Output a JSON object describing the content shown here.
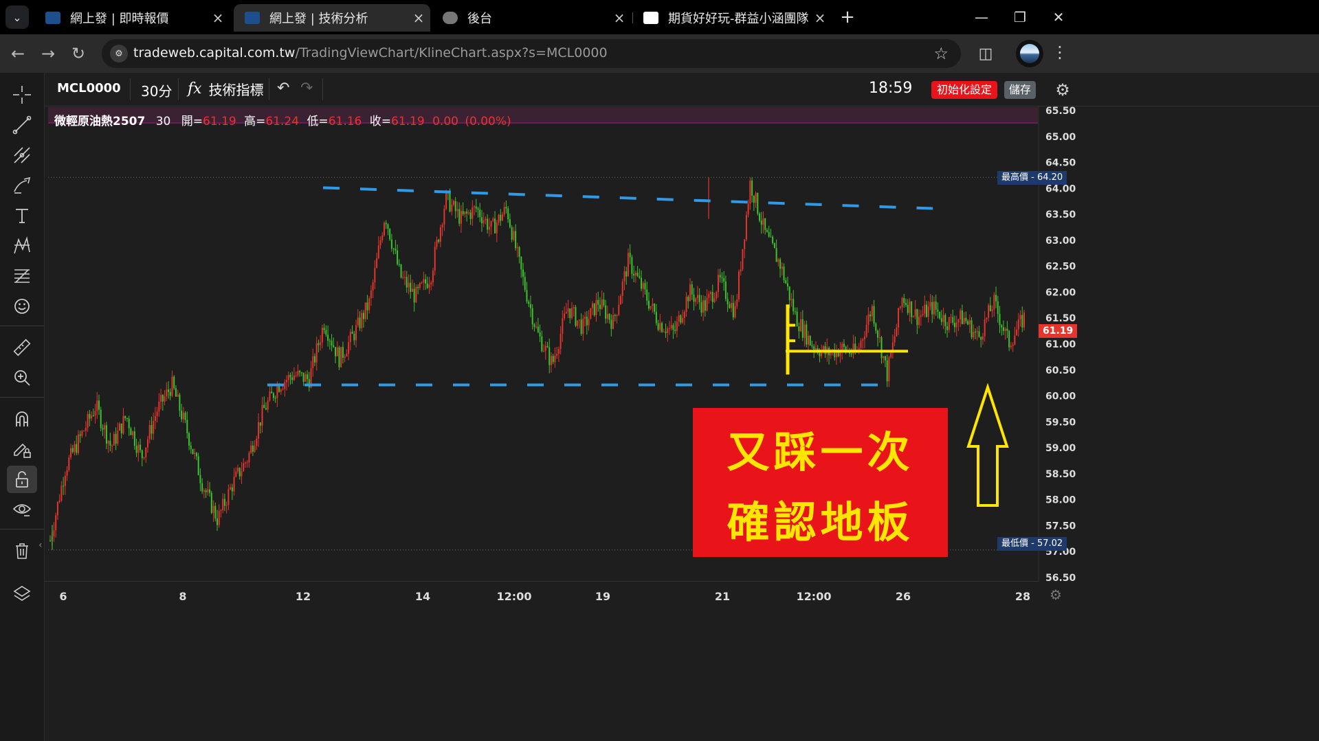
{
  "browser": {
    "tabs": [
      {
        "label": "網上發 | 即時報價",
        "active": false
      },
      {
        "label": "網上發 | 技術分析",
        "active": true
      },
      {
        "label": "後台",
        "active": false
      },
      {
        "label": "期貨好好玩-群益小涵團隊|唯一",
        "active": false
      }
    ],
    "url_host": "tradeweb.capital.com.tw",
    "url_path": "/TradingViewChart/KlineChart.aspx?s=MCL0000"
  },
  "toolbar": {
    "symbol": "MCL0000",
    "interval": "30分",
    "indicators_label": "技術指標",
    "indicators_icon": "fx",
    "time": "18:59",
    "reset_label": "初始化設定",
    "save_label": "儲存"
  },
  "legend": {
    "name": "微輕原油熱2507",
    "interval": "30",
    "open_label": "開=",
    "open": "61.19",
    "high_label": "高=",
    "high": "61.24",
    "low_label": "低=",
    "low": "61.16",
    "close_label": "收=",
    "close": "61.19",
    "change": "0.00",
    "change_pct": "(0.00%)"
  },
  "price_tags": {
    "high_label": "最高價",
    "high_value": "64.20",
    "low_label": "最低價",
    "low_value": "57.02",
    "last_value": "61.19"
  },
  "annotation": {
    "line1": "又踩一次",
    "line2": "確認地板"
  },
  "colors": {
    "up": "#e5352c",
    "down": "#3cc42a",
    "dashed_lines": "#2f9be8",
    "annotation_bg": "#e8141a",
    "annotation_text": "#ffe600",
    "marker": "#ffe600"
  },
  "chart_data": {
    "type": "candlestick",
    "symbol": "MCL0000",
    "y_ticks": [
      "65.50",
      "65.00",
      "64.50",
      "64.00",
      "63.50",
      "63.00",
      "62.50",
      "62.00",
      "61.50",
      "61.00",
      "60.50",
      "60.00",
      "59.50",
      "59.00",
      "58.50",
      "58.00",
      "57.50",
      "57.00",
      "56.50"
    ],
    "ylim": [
      56.5,
      65.5
    ],
    "x_ticks": [
      "6",
      "8",
      "12",
      "14",
      "12:00",
      "19",
      "21",
      "12:00",
      "26",
      "28"
    ],
    "close_path": [
      57.2,
      58.6,
      59.2,
      59.8,
      59.0,
      59.6,
      58.8,
      59.7,
      60.2,
      59.3,
      58.3,
      57.6,
      58.3,
      58.8,
      59.7,
      60.2,
      60.4,
      60.3,
      61.4,
      60.7,
      61.2,
      61.8,
      63.5,
      62.3,
      61.9,
      62.3,
      63.8,
      63.4,
      63.6,
      63.2,
      63.6,
      62.3,
      61.2,
      60.6,
      61.7,
      61.3,
      61.8,
      61.4,
      62.6,
      62.0,
      61.4,
      61.2,
      62.0,
      61.7,
      62.2,
      61.6,
      64.1,
      63.1,
      62.5,
      61.5,
      61.0,
      60.8,
      60.9,
      60.8,
      61.7,
      60.4,
      61.9,
      61.5,
      61.7,
      61.4,
      61.5,
      61.1,
      61.8,
      61.0,
      61.5
    ],
    "session_high": 64.2,
    "session_low": 57.02,
    "last": 61.19,
    "resistance_line": {
      "from": 64.0,
      "to": 63.6
    },
    "support_line": 60.2
  }
}
